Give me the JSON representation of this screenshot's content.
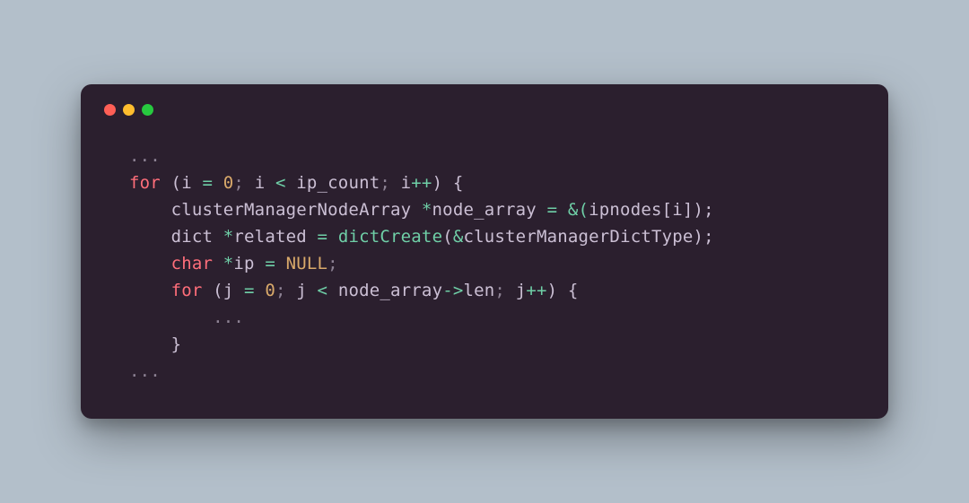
{
  "colors": {
    "background": "#b3bfca",
    "window_bg": "#2b1f2e",
    "dot_red": "#ff5f56",
    "dot_yellow": "#ffbd2e",
    "dot_green": "#27c93f",
    "keyword": "#ff6e7a",
    "function": "#6fcfa7",
    "number": "#d9a96a",
    "text": "#cbbfd4",
    "dim": "#8d8294"
  },
  "code": {
    "ellipsis": "...",
    "line1": {
      "for": "for",
      "open_paren": " (",
      "i": "i",
      "sp": " ",
      "eq": "=",
      "sp2": " ",
      "zero": "0",
      "semi1": "; ",
      "i2": "i",
      "lt": " < ",
      "ip_count": "ip_count",
      "semi2": "; ",
      "i3": "i",
      "inc": "++",
      "close": ") {"
    },
    "line2": {
      "indent": "    ",
      "type": "clusterManagerNodeArray",
      "sp": " ",
      "star": "*",
      "name": "node_array",
      "eq": " = ",
      "amp": "&(",
      "arr": "ipnodes",
      "br": "[",
      "i": "i",
      "brc": "]);"
    },
    "line3": {
      "indent": "    ",
      "type": "dict",
      "sp": " ",
      "star": "*",
      "name": "related",
      "eq": " = ",
      "fn": "dictCreate",
      "open": "(",
      "amp": "&",
      "arg": "clusterManagerDictType",
      "close": ");"
    },
    "line4": {
      "indent": "    ",
      "type": "char",
      "sp": " ",
      "star": "*",
      "name": "ip",
      "eq": " = ",
      "null": "NULL",
      "semi": ";"
    },
    "line5": {
      "indent": "    ",
      "for": "for",
      "open_paren": " (",
      "j": "j",
      "sp": " ",
      "eq": "=",
      "sp2": " ",
      "zero": "0",
      "semi1": "; ",
      "j2": "j",
      "lt": " < ",
      "na": "node_array",
      "arrow": "->",
      "len": "len",
      "semi2": "; ",
      "j3": "j",
      "inc": "++",
      "close": ") {"
    },
    "line6": {
      "indent": "        ",
      "ellipsis": "..."
    },
    "line7": {
      "indent": "    ",
      "brace": "}"
    },
    "line8": {
      "ellipsis": "..."
    }
  }
}
